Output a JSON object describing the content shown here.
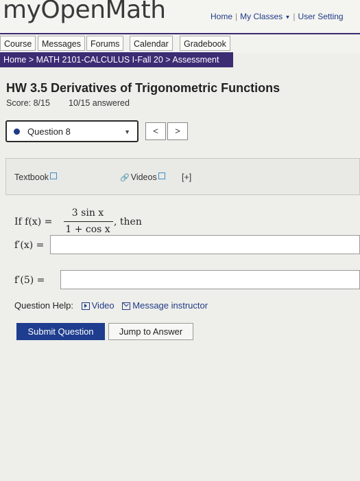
{
  "header": {
    "logo": "myOpenMath",
    "links": {
      "home": "Home",
      "my_classes": "My Classes",
      "user_settings": "User Setting"
    },
    "sep": "|"
  },
  "nav": {
    "tabs": [
      "Course",
      "Messages",
      "Forums",
      "Calendar",
      "Gradebook"
    ]
  },
  "breadcrumb": "Home > MATH 2101-CALCULUS I-Fall 20 > Assessment",
  "assessment": {
    "title": "HW 3.5 Derivatives of Trigonometric Functions",
    "score": "Score: 8/15",
    "answered": "10/15 answered"
  },
  "question_nav": {
    "selected": "Question 8",
    "prev": "<",
    "next": ">"
  },
  "tools": {
    "textbook": "Textbook",
    "videos": "Videos",
    "expand": "[+]"
  },
  "question": {
    "prefix": "If f(x) =",
    "numerator": "3 sin x",
    "denominator": "1 + cos x",
    "suffix": ", then",
    "part1_label": "f′(x) =",
    "part1_value": "",
    "part2_label": "f′(5) =",
    "part2_value": ""
  },
  "help": {
    "label": "Question Help:",
    "video": "Video",
    "message": "Message instructor"
  },
  "buttons": {
    "submit": "Submit Question",
    "jump": "Jump to Answer"
  },
  "colors": {
    "accent": "#1e3d8f",
    "nav_bar": "#3b2c74"
  }
}
